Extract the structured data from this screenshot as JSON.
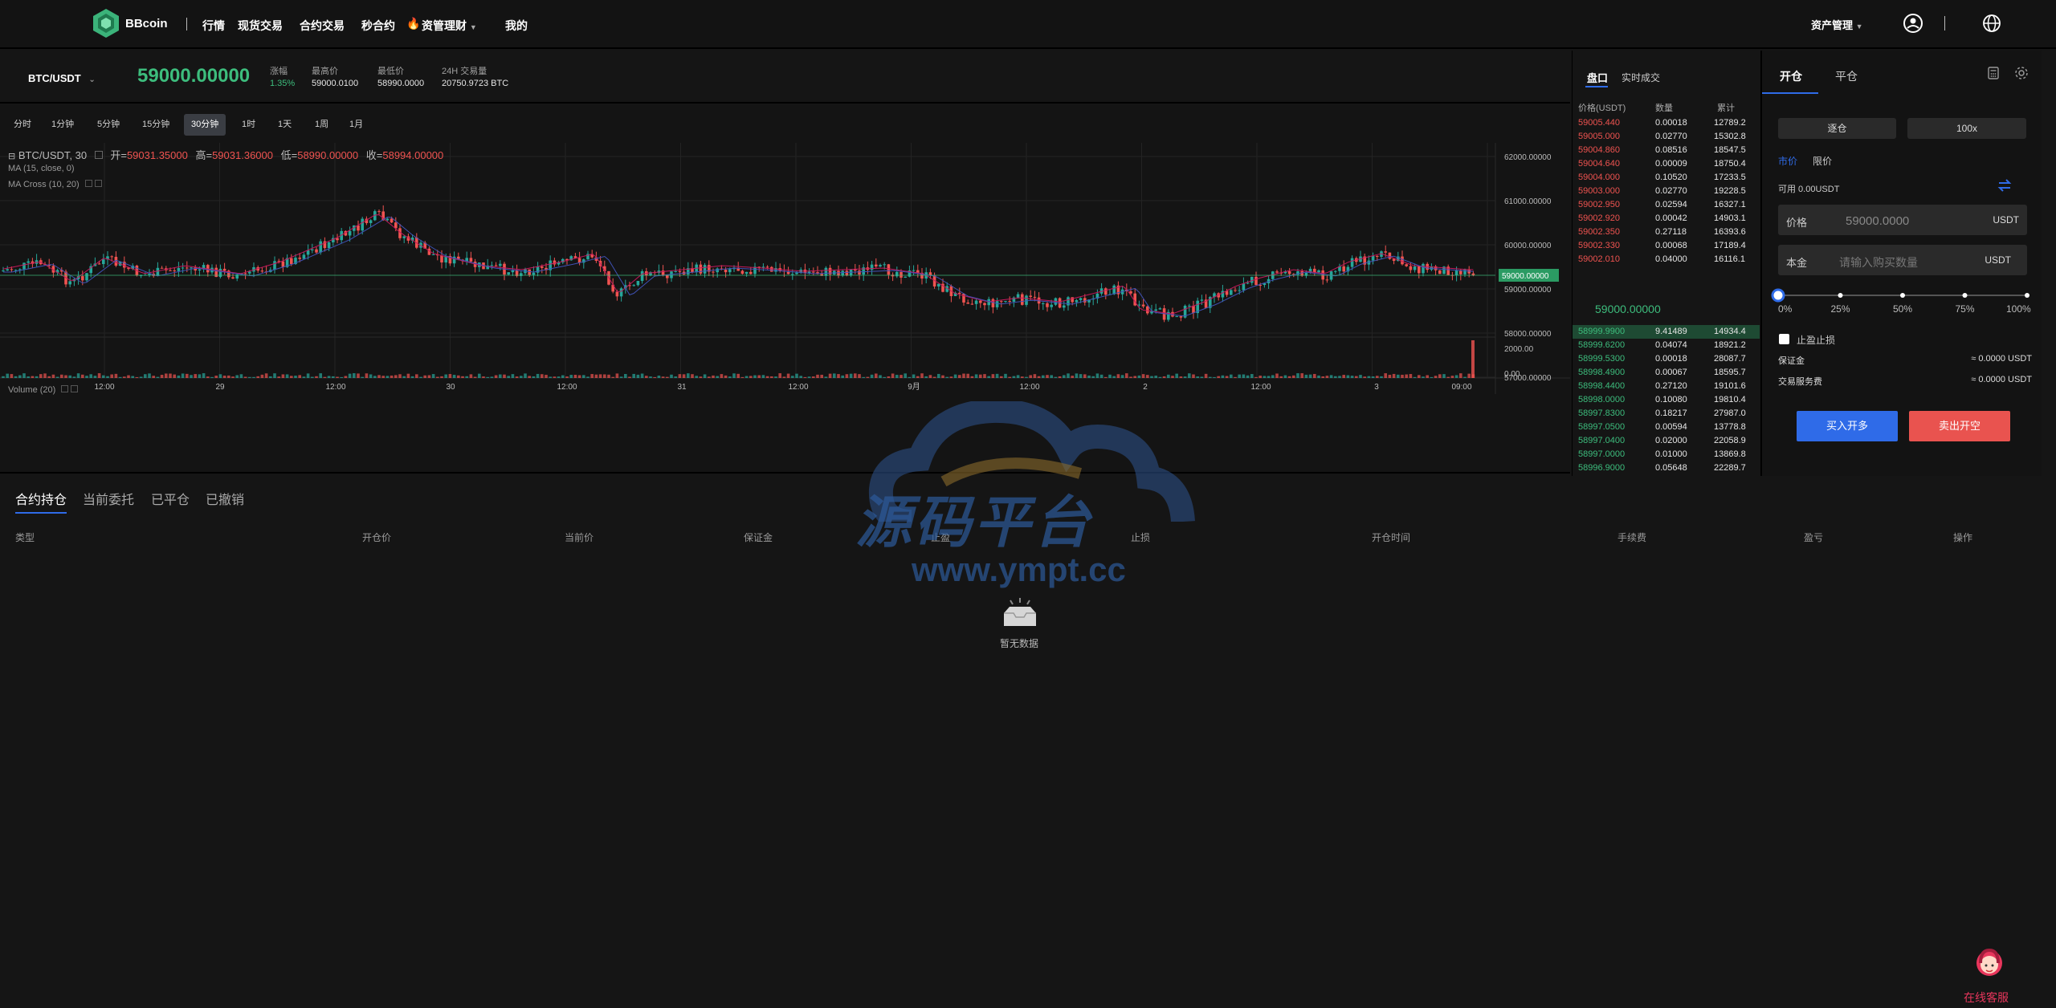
{
  "brand": "BBcoin",
  "nav": {
    "items": [
      "行情",
      "现货交易",
      "合约交易",
      "秒合约",
      "资管理财",
      "我的"
    ],
    "asset_mgmt": "资产管理"
  },
  "ticker": {
    "pair": "BTC/USDT",
    "price": "59000.00000",
    "change_label": "涨幅",
    "change_value": "1.35%",
    "high_label": "最高价",
    "high_value": "59000.0100",
    "low_label": "最低价",
    "low_value": "58990.0000",
    "volume_label": "24H 交易量",
    "volume_value": "20750.9723 BTC"
  },
  "timeframes": [
    "分时",
    "1分钟",
    "5分钟",
    "15分钟",
    "30分钟",
    "1时",
    "1天",
    "1周",
    "1月"
  ],
  "active_timeframe": "30分钟",
  "chart": {
    "legend_title": "BTC/USDT, 30",
    "ohlc": {
      "open_label": "开=",
      "open": "59031.35000",
      "high_label": "高=",
      "high": "59031.36000",
      "low_label": "低=",
      "low": "58990.00000",
      "close_label": "收=",
      "close": "58994.00000"
    },
    "ma_label": "MA (15, close, 0)",
    "ma_cross_label": "MA Cross (10, 20)",
    "volume_label": "Volume (20)",
    "price_ticks": [
      "62000.00000",
      "61000.00000",
      "60000.00000",
      "59000.00000",
      "58000.00000",
      "57000.00000"
    ],
    "current_price_tag": "59000.00000",
    "volume_ticks": [
      "2000.00",
      "0.00"
    ],
    "x_ticks": [
      "12:00",
      "29",
      "12:00",
      "30",
      "12:00",
      "31",
      "12:00",
      "9月",
      "12:00",
      "2",
      "12:00",
      "3",
      "09:00"
    ]
  },
  "orderbook": {
    "tabs": [
      "盘口",
      "实时成交"
    ],
    "headers": [
      "价格(USDT)",
      "数量",
      "累计"
    ],
    "asks": [
      [
        "59005.440",
        "0.00018",
        "12789.2"
      ],
      [
        "59005.000",
        "0.02770",
        "15302.8"
      ],
      [
        "59004.860",
        "0.08516",
        "18547.5"
      ],
      [
        "59004.640",
        "0.00009",
        "18750.4"
      ],
      [
        "59004.000",
        "0.10520",
        "17233.5"
      ],
      [
        "59003.000",
        "0.02770",
        "19228.5"
      ],
      [
        "59002.950",
        "0.02594",
        "16327.1"
      ],
      [
        "59002.920",
        "0.00042",
        "14903.1"
      ],
      [
        "59002.350",
        "0.27118",
        "16393.6"
      ],
      [
        "59002.330",
        "0.00068",
        "17189.4"
      ],
      [
        "59002.010",
        "0.04000",
        "16116.1"
      ]
    ],
    "mid_price": "59000.00000",
    "bids": [
      [
        "58999.9900",
        "9.41489",
        "14934.4"
      ],
      [
        "58999.6200",
        "0.04074",
        "18921.2"
      ],
      [
        "58999.5300",
        "0.00018",
        "28087.7"
      ],
      [
        "58998.4900",
        "0.00067",
        "18595.7"
      ],
      [
        "58998.4400",
        "0.27120",
        "19101.6"
      ],
      [
        "58998.0000",
        "0.10080",
        "19810.4"
      ],
      [
        "58997.8300",
        "0.18217",
        "27987.0"
      ],
      [
        "58997.0500",
        "0.00594",
        "13778.8"
      ],
      [
        "58997.0400",
        "0.02000",
        "22058.9"
      ],
      [
        "58997.0000",
        "0.01000",
        "13869.8"
      ],
      [
        "58996.9000",
        "0.05648",
        "22289.7"
      ]
    ]
  },
  "trade": {
    "tabs": [
      "开仓",
      "平仓"
    ],
    "margin_mode": "逐仓",
    "leverage": "100x",
    "order_types": [
      "市价",
      "限价"
    ],
    "available": "可用 0.00USDT",
    "price_label": "价格",
    "price_value": "59000.0000",
    "price_unit": "USDT",
    "amount_label": "本金",
    "amount_placeholder": "请输入购买数量",
    "amount_unit": "USDT",
    "slider_marks": [
      "0%",
      "25%",
      "50%",
      "75%",
      "100%"
    ],
    "slider_value": 0,
    "tp_sl_label": "止盈止损",
    "margin_label": "保证金",
    "margin_value": "≈ 0.0000 USDT",
    "fee_label": "交易服务费",
    "fee_value": "≈ 0.0000 USDT",
    "buy_label": "买入开多",
    "sell_label": "卖出开空"
  },
  "bottom": {
    "tabs": [
      "合约持仓",
      "当前委托",
      "已平仓",
      "已撤销"
    ],
    "columns": [
      "类型",
      "开仓价",
      "当前价",
      "保证金",
      "止盈",
      "止损",
      "开仓时间",
      "手续费",
      "盈亏",
      "操作"
    ],
    "empty_text": "暂无数据"
  },
  "watermark": {
    "title": "源码平台",
    "url": "www.ympt.cc"
  },
  "support_label": "在线客服",
  "colors": {
    "up": "#26a69a",
    "down": "#ef5350",
    "buy": "#2f6be8",
    "sell": "#e9534f",
    "price_green": "#3dbd7d"
  }
}
